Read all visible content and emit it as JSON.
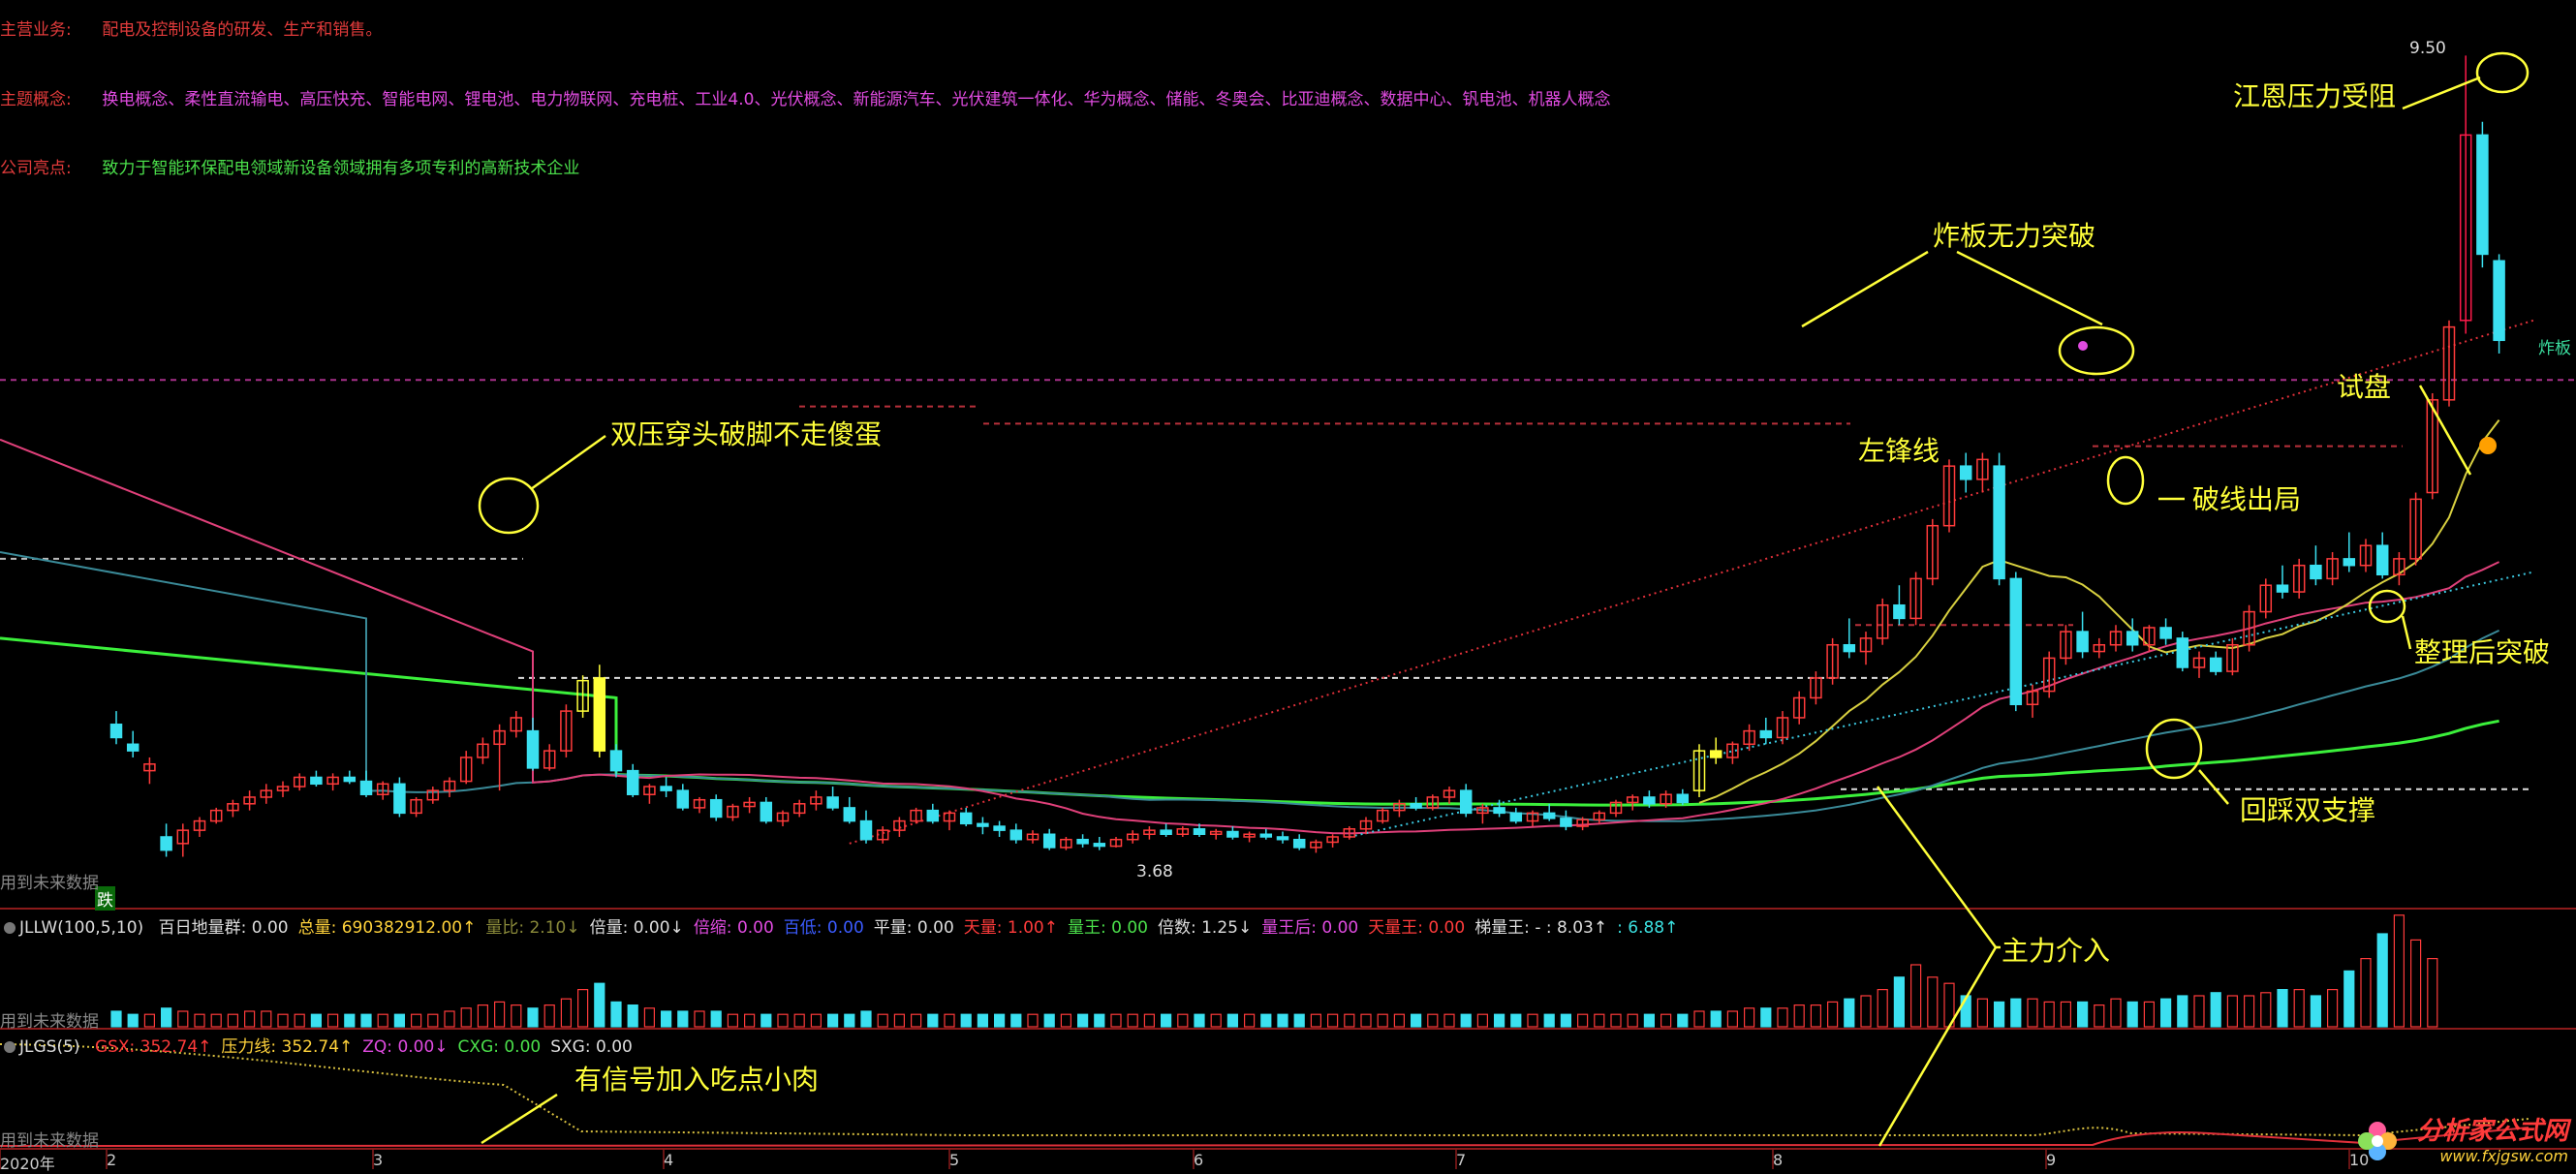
{
  "info": {
    "business_key": "主营业务:",
    "business_val": "配电及控制设备的研发、生产和销售。",
    "concept_key": "主题概念:",
    "concept_val": "换电概念、柔性直流输电、高压快充、智能电网、锂电池、电力物联网、充电桩、工业4.0、光伏概念、新能源汽车、光伏建筑一体化、华为概念、储能、冬奥会、比亚迪概念、数据中心、钒电池、机器人概念",
    "highlight_key": "公司亮点:",
    "highlight_val": "致力于智能环保配电领域新设备领域拥有多项专利的高新技术企业"
  },
  "annotations": {
    "jiangen": "江恩压力受阻",
    "zhaban": "炸板无力突破",
    "shipan": "试盘",
    "zuofeng": "左锋线",
    "poxian": "破线出局",
    "shuangya": "双压穿头破脚不走傻蛋",
    "zhengli": "整理后突破",
    "huicai": "回踩双支撑",
    "zhuli": "主力介入",
    "xinhao": "有信号加入吃点小肉"
  },
  "price_labels": {
    "high": "9.50",
    "low": "3.68",
    "zhaban_short": "炸板",
    "die": "跌",
    "future_1": "用到未来数据",
    "future_2": "用到未来数据",
    "future_3": "用到未来数据"
  },
  "volume_indicator": {
    "name": "JLLW(100,5,10)",
    "items": [
      {
        "label": "百日地量群:",
        "value": "0.00",
        "color": "#dddddd"
      },
      {
        "label": "总量:",
        "value": "690382912.00↑",
        "color": "#ffd23b"
      },
      {
        "label": "量比:",
        "value": "2.10↓",
        "color": "#8a8a3a"
      },
      {
        "label": "倍量:",
        "value": "0.00↓",
        "color": "#dddddd"
      },
      {
        "label": "倍缩:",
        "value": "0.00",
        "color": "#e04be0"
      },
      {
        "label": "百低:",
        "value": "0.00",
        "color": "#3b5bff"
      },
      {
        "label": "平量:",
        "value": "0.00",
        "color": "#dddddd"
      },
      {
        "label": "天量:",
        "value": "1.00↑",
        "color": "#ff3b3b"
      },
      {
        "label": "量王:",
        "value": "0.00",
        "color": "#4be04b"
      },
      {
        "label": "倍数:",
        "value": "1.25↓",
        "color": "#dddddd"
      },
      {
        "label": "量王后:",
        "value": "0.00",
        "color": "#e04be0"
      },
      {
        "label": "天量王:",
        "value": "0.00",
        "color": "#ff3b3b"
      },
      {
        "label": "梯量王:",
        "value": "- : 8.03↑",
        "color": "#dddddd"
      },
      {
        "label": ":",
        "value": "6.88↑",
        "color": "#3be0e0"
      }
    ]
  },
  "pressure_indicator": {
    "name": "JLGS(5)",
    "items": [
      {
        "label": "GSX:",
        "value": "352.74↑",
        "color": "#ff3b3b"
      },
      {
        "label": "压力线:",
        "value": "352.74↑",
        "color": "#ffd23b"
      },
      {
        "label": "ZQ:",
        "value": "0.00↓",
        "color": "#e04be0"
      },
      {
        "label": "CXG:",
        "value": "0.00",
        "color": "#4be04b"
      },
      {
        "label": "SXG:",
        "value": "0.00",
        "color": "#dddddd"
      }
    ]
  },
  "months": [
    "2020年",
    "2",
    "3",
    "4",
    "5",
    "6",
    "7",
    "8",
    "9",
    "10"
  ],
  "watermark": {
    "line1": "分析家公式网",
    "line2": "www.fxjgsw.com"
  },
  "colors": {
    "up": "#ff3b3b",
    "down": "#3be0f0",
    "ma_green": "#3bf03b",
    "ma_pink": "#e0407a",
    "ma_teal": "#3a8a98",
    "ma_yellow": "#d8d040",
    "signal": "#ffff3a"
  },
  "chart_data": {
    "type": "candlestick",
    "title": "",
    "xlabel": "",
    "ylabel": "",
    "ylim": [
      3.3,
      9.7
    ],
    "grid": false,
    "x_months": [
      "2020年",
      "2",
      "3",
      "4",
      "5",
      "6",
      "7",
      "8",
      "9",
      "10"
    ],
    "annotated_prices": {
      "high": 9.5,
      "low": 3.68
    },
    "ohlc": [
      [
        4.45,
        4.55,
        4.3,
        4.35
      ],
      [
        4.3,
        4.4,
        4.2,
        4.25
      ],
      [
        4.1,
        4.2,
        4.0,
        4.15
      ],
      [
        3.6,
        3.7,
        3.45,
        3.5
      ],
      [
        3.55,
        3.7,
        3.45,
        3.65
      ],
      [
        3.65,
        3.75,
        3.6,
        3.72
      ],
      [
        3.72,
        3.82,
        3.7,
        3.8
      ],
      [
        3.8,
        3.88,
        3.75,
        3.85
      ],
      [
        3.85,
        3.95,
        3.8,
        3.9
      ],
      [
        3.9,
        4.0,
        3.85,
        3.95
      ],
      [
        3.95,
        4.02,
        3.9,
        3.98
      ],
      [
        3.98,
        4.08,
        3.95,
        4.05
      ],
      [
        4.05,
        4.1,
        3.98,
        4.0
      ],
      [
        4.0,
        4.08,
        3.95,
        4.05
      ],
      [
        4.05,
        4.1,
        4.0,
        4.02
      ],
      [
        4.02,
        4.1,
        3.9,
        3.92
      ],
      [
        3.92,
        4.02,
        3.88,
        4.0
      ],
      [
        4.0,
        4.05,
        3.75,
        3.78
      ],
      [
        3.78,
        3.9,
        3.75,
        3.88
      ],
      [
        3.88,
        3.98,
        3.85,
        3.95
      ],
      [
        3.95,
        4.05,
        3.9,
        4.02
      ],
      [
        4.02,
        4.25,
        4.0,
        4.2
      ],
      [
        4.2,
        4.35,
        4.15,
        4.3
      ],
      [
        4.3,
        4.45,
        3.95,
        4.4
      ],
      [
        4.4,
        4.55,
        4.35,
        4.5
      ],
      [
        4.4,
        4.5,
        4.1,
        4.12
      ],
      [
        4.12,
        4.3,
        4.1,
        4.25
      ],
      [
        4.25,
        4.6,
        4.2,
        4.55
      ],
      [
        4.55,
        4.82,
        4.5,
        4.78
      ],
      [
        4.8,
        4.9,
        4.2,
        4.25
      ],
      [
        4.25,
        4.3,
        4.05,
        4.1
      ],
      [
        4.1,
        4.15,
        3.9,
        3.92
      ],
      [
        3.92,
        4.0,
        3.85,
        3.98
      ],
      [
        3.98,
        4.05,
        3.9,
        3.95
      ],
      [
        3.95,
        4.0,
        3.8,
        3.82
      ],
      [
        3.82,
        3.9,
        3.78,
        3.88
      ],
      [
        3.88,
        3.92,
        3.72,
        3.75
      ],
      [
        3.75,
        3.85,
        3.72,
        3.83
      ],
      [
        3.83,
        3.9,
        3.78,
        3.86
      ],
      [
        3.86,
        3.9,
        3.7,
        3.72
      ],
      [
        3.72,
        3.8,
        3.68,
        3.78
      ],
      [
        3.78,
        3.88,
        3.75,
        3.85
      ],
      [
        3.85,
        3.95,
        3.8,
        3.9
      ],
      [
        3.9,
        3.98,
        3.8,
        3.82
      ],
      [
        3.82,
        3.9,
        3.7,
        3.72
      ],
      [
        3.72,
        3.8,
        3.55,
        3.58
      ],
      [
        3.58,
        3.68,
        3.55,
        3.65
      ],
      [
        3.65,
        3.75,
        3.6,
        3.72
      ],
      [
        3.72,
        3.82,
        3.7,
        3.8
      ],
      [
        3.8,
        3.85,
        3.7,
        3.72
      ],
      [
        3.72,
        3.8,
        3.65,
        3.78
      ],
      [
        3.78,
        3.82,
        3.68,
        3.7
      ],
      [
        3.7,
        3.75,
        3.62,
        3.68
      ],
      [
        3.68,
        3.72,
        3.6,
        3.65
      ],
      [
        3.65,
        3.7,
        3.55,
        3.58
      ],
      [
        3.58,
        3.65,
        3.55,
        3.62
      ],
      [
        3.62,
        3.66,
        3.5,
        3.52
      ],
      [
        3.52,
        3.6,
        3.5,
        3.58
      ],
      [
        3.58,
        3.62,
        3.52,
        3.55
      ],
      [
        3.55,
        3.6,
        3.5,
        3.53
      ],
      [
        3.53,
        3.6,
        3.52,
        3.58
      ],
      [
        3.58,
        3.65,
        3.55,
        3.62
      ],
      [
        3.62,
        3.68,
        3.58,
        3.65
      ],
      [
        3.65,
        3.7,
        3.6,
        3.62
      ],
      [
        3.62,
        3.68,
        3.6,
        3.66
      ],
      [
        3.66,
        3.7,
        3.6,
        3.62
      ],
      [
        3.62,
        3.66,
        3.58,
        3.64
      ],
      [
        3.64,
        3.68,
        3.58,
        3.6
      ],
      [
        3.6,
        3.64,
        3.56,
        3.62
      ],
      [
        3.62,
        3.66,
        3.58,
        3.6
      ],
      [
        3.6,
        3.64,
        3.55,
        3.58
      ],
      [
        3.58,
        3.62,
        3.5,
        3.52
      ],
      [
        3.52,
        3.58,
        3.48,
        3.56
      ],
      [
        3.56,
        3.62,
        3.52,
        3.6
      ],
      [
        3.6,
        3.68,
        3.58,
        3.66
      ],
      [
        3.66,
        3.75,
        3.62,
        3.72
      ],
      [
        3.72,
        3.82,
        3.7,
        3.8
      ],
      [
        3.8,
        3.88,
        3.75,
        3.85
      ],
      [
        3.85,
        3.9,
        3.8,
        3.82
      ],
      [
        3.82,
        3.92,
        3.8,
        3.9
      ],
      [
        3.9,
        3.98,
        3.85,
        3.95
      ],
      [
        3.95,
        4.0,
        3.75,
        3.78
      ],
      [
        3.78,
        3.85,
        3.7,
        3.82
      ],
      [
        3.82,
        3.88,
        3.75,
        3.78
      ],
      [
        3.78,
        3.82,
        3.7,
        3.72
      ],
      [
        3.72,
        3.8,
        3.68,
        3.78
      ],
      [
        3.78,
        3.85,
        3.72,
        3.74
      ],
      [
        3.74,
        3.8,
        3.65,
        3.68
      ],
      [
        3.68,
        3.75,
        3.65,
        3.73
      ],
      [
        3.73,
        3.8,
        3.7,
        3.78
      ],
      [
        3.78,
        3.88,
        3.75,
        3.86
      ],
      [
        3.86,
        3.92,
        3.8,
        3.9
      ],
      [
        3.9,
        3.95,
        3.82,
        3.85
      ],
      [
        3.85,
        3.95,
        3.82,
        3.92
      ],
      [
        3.92,
        3.96,
        3.84,
        3.86
      ],
      [
        3.95,
        4.3,
        3.9,
        4.25
      ],
      [
        4.25,
        4.35,
        4.15,
        4.2
      ],
      [
        4.2,
        4.32,
        4.15,
        4.3
      ],
      [
        4.3,
        4.45,
        4.25,
        4.4
      ],
      [
        4.4,
        4.5,
        4.3,
        4.35
      ],
      [
        4.35,
        4.55,
        4.3,
        4.5
      ],
      [
        4.5,
        4.7,
        4.45,
        4.65
      ],
      [
        4.65,
        4.85,
        4.6,
        4.8
      ],
      [
        4.8,
        5.1,
        4.75,
        5.05
      ],
      [
        5.05,
        5.25,
        4.95,
        5.0
      ],
      [
        5.0,
        5.15,
        4.9,
        5.1
      ],
      [
        5.1,
        5.4,
        5.05,
        5.35
      ],
      [
        5.35,
        5.5,
        5.2,
        5.25
      ],
      [
        5.25,
        5.6,
        5.2,
        5.55
      ],
      [
        5.55,
        6.0,
        5.5,
        5.95
      ],
      [
        5.95,
        6.45,
        5.9,
        6.4
      ],
      [
        6.4,
        6.5,
        6.2,
        6.3
      ],
      [
        6.3,
        6.5,
        6.2,
        6.45
      ],
      [
        6.4,
        6.5,
        5.5,
        5.55
      ],
      [
        5.55,
        5.6,
        4.55,
        4.6
      ],
      [
        4.6,
        4.75,
        4.5,
        4.7
      ],
      [
        4.7,
        5.0,
        4.65,
        4.95
      ],
      [
        4.95,
        5.2,
        4.9,
        5.15
      ],
      [
        5.15,
        5.3,
        4.95,
        5.0
      ],
      [
        5.0,
        5.1,
        4.95,
        5.05
      ],
      [
        5.05,
        5.2,
        5.0,
        5.15
      ],
      [
        5.15,
        5.25,
        5.0,
        5.05
      ],
      [
        5.05,
        5.2,
        5.0,
        5.18
      ],
      [
        5.18,
        5.25,
        5.05,
        5.1
      ],
      [
        5.1,
        5.15,
        4.85,
        4.88
      ],
      [
        4.88,
        5.0,
        4.8,
        4.95
      ],
      [
        4.95,
        5.0,
        4.82,
        4.85
      ],
      [
        4.85,
        5.1,
        4.82,
        5.05
      ],
      [
        5.05,
        5.35,
        5.0,
        5.3
      ],
      [
        5.3,
        5.55,
        5.25,
        5.5
      ],
      [
        5.5,
        5.65,
        5.4,
        5.45
      ],
      [
        5.45,
        5.7,
        5.4,
        5.65
      ],
      [
        5.65,
        5.8,
        5.5,
        5.55
      ],
      [
        5.55,
        5.75,
        5.5,
        5.7
      ],
      [
        5.7,
        5.9,
        5.6,
        5.65
      ],
      [
        5.65,
        5.85,
        5.6,
        5.8
      ],
      [
        5.8,
        5.9,
        5.55,
        5.58
      ],
      [
        5.58,
        5.75,
        5.5,
        5.7
      ],
      [
        5.7,
        6.2,
        5.65,
        6.15
      ],
      [
        6.2,
        6.95,
        6.15,
        6.9
      ],
      [
        6.9,
        7.5,
        6.85,
        7.45
      ],
      [
        7.5,
        9.5,
        7.4,
        8.9
      ],
      [
        8.9,
        9.0,
        7.9,
        8.0
      ],
      [
        7.95,
        8.0,
        7.25,
        7.35
      ]
    ],
    "volume": [
      5,
      4,
      4,
      6,
      5,
      4,
      4,
      4,
      5,
      5,
      4,
      4,
      4,
      4,
      4,
      4,
      4,
      4,
      4,
      4,
      5,
      6,
      7,
      8,
      7,
      6,
      7,
      9,
      12,
      14,
      8,
      7,
      6,
      5,
      5,
      5,
      5,
      4,
      4,
      4,
      4,
      4,
      4,
      4,
      4,
      5,
      4,
      4,
      4,
      4,
      4,
      4,
      4,
      4,
      4,
      4,
      4,
      4,
      4,
      4,
      4,
      4,
      4,
      4,
      4,
      4,
      4,
      4,
      4,
      4,
      4,
      4,
      4,
      4,
      4,
      4,
      4,
      4,
      4,
      4,
      4,
      4,
      4,
      4,
      4,
      4,
      4,
      4,
      4,
      4,
      4,
      4,
      4,
      4,
      4,
      5,
      5,
      5,
      6,
      6,
      6,
      7,
      7,
      8,
      9,
      10,
      12,
      16,
      20,
      16,
      14,
      10,
      9,
      8,
      9,
      9,
      8,
      8,
      8,
      7,
      9,
      8,
      8,
      9,
      10,
      10,
      11,
      10,
      10,
      11,
      12,
      12,
      10,
      12,
      18,
      22,
      30,
      36,
      28,
      22
    ]
  }
}
